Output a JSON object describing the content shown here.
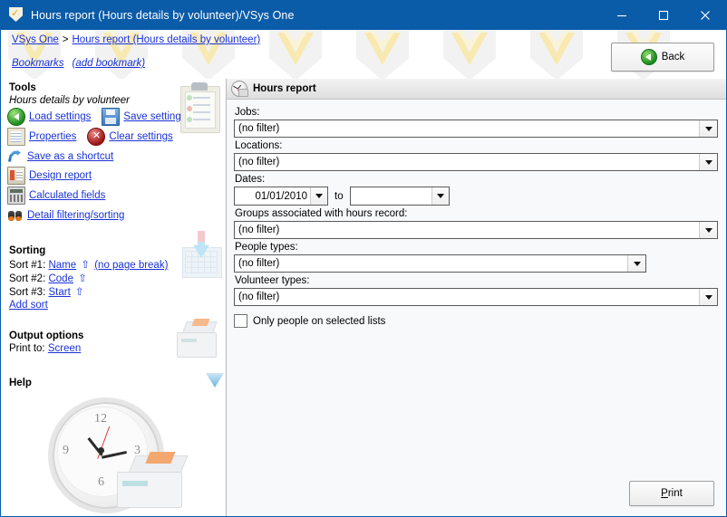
{
  "window": {
    "title": "Hours report (Hours details by volunteer)/VSys One",
    "app_icon": "vsys-shield-icon",
    "controls": {
      "minimize": "minimize-icon",
      "maximize": "maximize-icon",
      "close": "close-icon"
    },
    "titlebar_color": "#0a5ba8"
  },
  "header": {
    "breadcrumb": {
      "home": "VSys One",
      "separator": ">",
      "current": "Hours report (Hours details by volunteer)"
    },
    "bookmarks": {
      "label": "Bookmarks",
      "add": "(add bookmark)"
    },
    "back_button": "Back"
  },
  "sidebar": {
    "tools_title": "Tools",
    "tools_subtitle": "Hours details by volunteer",
    "tools": [
      {
        "label": "Load settings",
        "icon": "load-settings-icon"
      },
      {
        "label": "Save settings",
        "icon": "save-settings-icon"
      },
      {
        "label": "Properties",
        "icon": "properties-icon"
      },
      {
        "label": "Clear settings",
        "icon": "clear-settings-icon"
      },
      {
        "label": "Save as a shortcut",
        "icon": "shortcut-icon"
      },
      {
        "label": "Design report",
        "icon": "design-report-icon"
      },
      {
        "label": "Calculated fields",
        "icon": "calculated-fields-icon"
      },
      {
        "label": "Detail filtering/sorting",
        "icon": "binoculars-icon"
      }
    ],
    "sorting_title": "Sorting",
    "sorts": [
      {
        "prefix": "Sort #1:",
        "field": "Name",
        "direction": "⇧",
        "extra": "(no page break)"
      },
      {
        "prefix": "Sort #2:",
        "field": "Code",
        "direction": "⇧",
        "extra": ""
      },
      {
        "prefix": "Sort #3:",
        "field": "Start",
        "direction": "⇧",
        "extra": ""
      }
    ],
    "add_sort": "Add sort",
    "output_title": "Output options",
    "print_to_label": "Print to:",
    "print_to_value": "Screen",
    "help_title": "Help"
  },
  "panel": {
    "title": "Hours report",
    "title_icon": "clock-printer-icon",
    "fields": [
      {
        "label": "Jobs:",
        "value": "(no filter)",
        "name": "jobs"
      },
      {
        "label": "Locations:",
        "value": "(no filter)",
        "name": "locations"
      },
      {
        "label": "Groups associated with hours record:",
        "value": "(no filter)",
        "name": "groups"
      },
      {
        "label": "People types:",
        "value": "(no filter)",
        "name": "people-types"
      },
      {
        "label": "Volunteer types:",
        "value": "(no filter)",
        "name": "volunteer-types"
      }
    ],
    "dates": {
      "label": "Dates:",
      "from": "01/01/2010",
      "to_label": "to",
      "to": ""
    },
    "checkbox": {
      "label": "Only people on selected lists",
      "checked": false
    },
    "print_button": {
      "accel": "P",
      "rest": "rint"
    }
  },
  "colors": {
    "link": "#1a32d8",
    "title_bar": "#0a5ba8",
    "panel_bg": "#f7f9fb"
  }
}
